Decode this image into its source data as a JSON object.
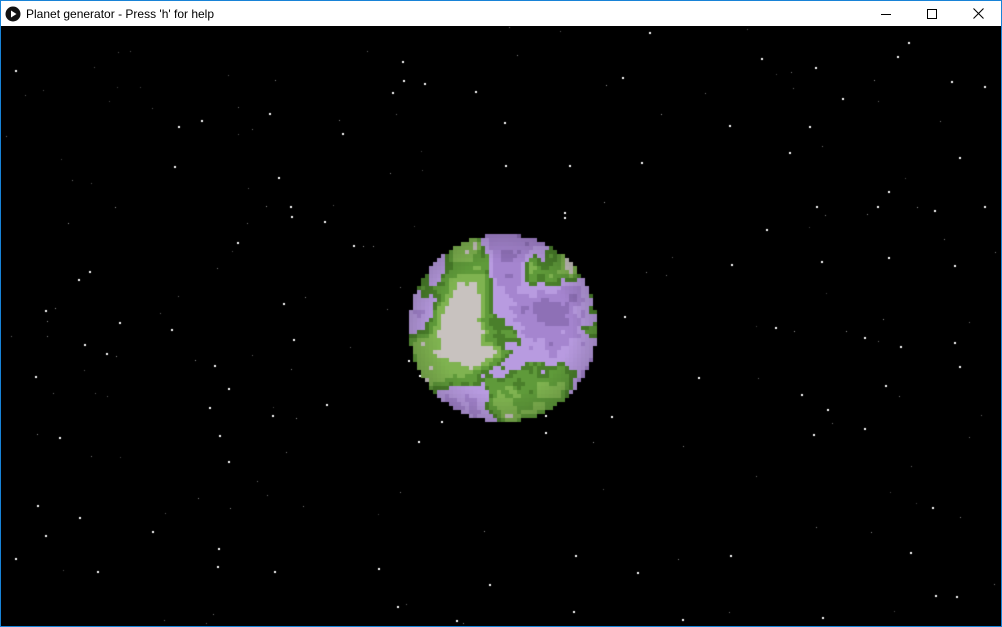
{
  "window": {
    "title": "Planet generator - Press 'h' for help",
    "app_icon": "play-icon",
    "controls": {
      "minimize_icon": "minimize-icon",
      "maximize_icon": "maximize-icon",
      "close_icon": "close-icon"
    }
  },
  "scene": {
    "background_color": "#000000",
    "star_color": "#ffffff",
    "planet_colors": {
      "ocean": "#a585cf",
      "ocean_shallow": "#b89be0",
      "ocean_deep": "#8e70b6",
      "land": "#5f9a3a",
      "land_light": "#7fb350",
      "land_dark": "#4a7f2b",
      "snow": "#c8c2bf"
    }
  }
}
